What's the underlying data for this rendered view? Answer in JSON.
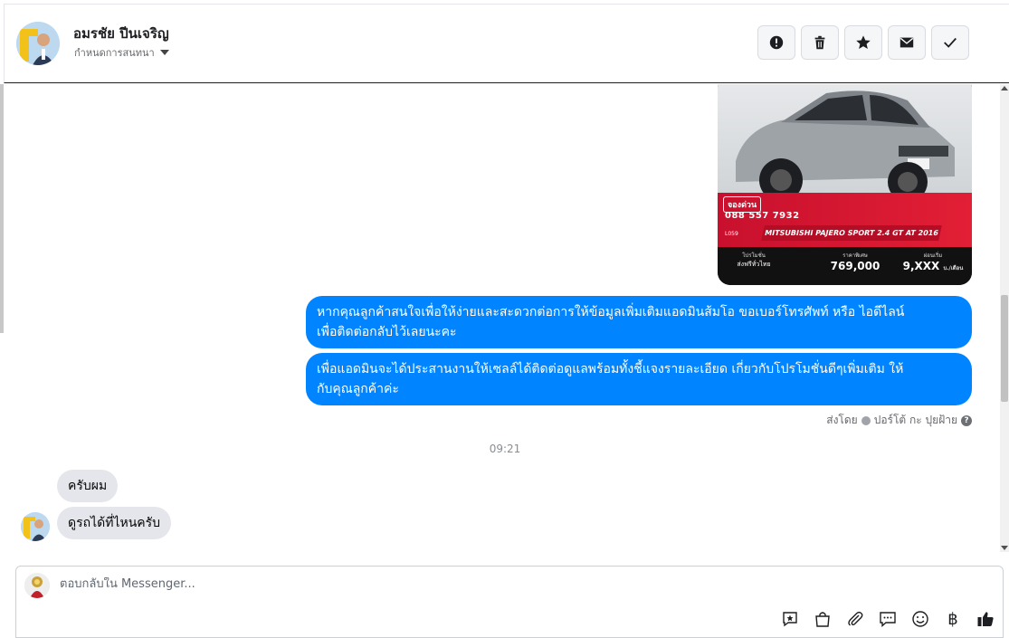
{
  "header": {
    "name": "อมรชัย ปีนเจริญ",
    "subtitle": "กำหนดการสนทนา",
    "actions": [
      "mark-spam-icon",
      "trash-icon",
      "star-icon",
      "envelope-icon",
      "check-icon"
    ]
  },
  "car_card": {
    "badge": "จองด่วน",
    "phone": "088 557 7932",
    "code": "L059",
    "model": "MITSUBISHI PAJERO SPORT 2.4 GT AT 2016",
    "col1_label": "โปรโมชั่น",
    "col1_value": "ส่งฟรีทั่วไทย",
    "col2_label": "ราคาพิเศษ",
    "col2_value": "769,000",
    "col3_label": "ผ่อนเริ่ม",
    "col3_value": "9,XXX",
    "col3_unit": "บ./เดือน",
    "colors": {
      "red": "#e21f35",
      "dark": "#111111"
    }
  },
  "messages_out": [
    {
      "line1": "หากคุณลูกค้าสนใจเพื่อให้ง่ายและสะดวกต่อการให้ข้อมูลเพิ่มเติมแอดมินส้มโอ ขอเบอร์โทรศัพท์ หรือ ไอดีไลน์",
      "line2": "เพื่อติดต่อกลับไว้เลยนะคะ"
    },
    {
      "line1": "เพื่อแอดมินจะได้ประสานงานให้เซลล์ได้ติดต่อดูแลพร้อมทั้งชี้แจงรายละเอียด เกี่ยวกับโปรโมชั่นดีๆเพิ่มเติม ให้",
      "line2": "กับคุณลูกค้าค่ะ"
    }
  ],
  "sent_by": {
    "prefix": "ส่งโดย",
    "name": "ปอร์โต้ กะ ปุยฝ้าย",
    "help": "?"
  },
  "timestamp": "09:21",
  "messages_in": [
    "ครับผม",
    "ดูรถได้ที่ไหนครับ"
  ],
  "composer": {
    "placeholder": "ตอบกลับใน Messenger...",
    "icons": [
      "saved-reply-icon",
      "shop-bag-icon",
      "attachment-icon",
      "chat-bubble-icon",
      "emoji-icon",
      "baht-icon",
      "like-icon"
    ],
    "baht_symbol": "฿"
  },
  "colors": {
    "outgoing_bubble": "#0084ff",
    "incoming_bubble": "#e4e6eb"
  }
}
